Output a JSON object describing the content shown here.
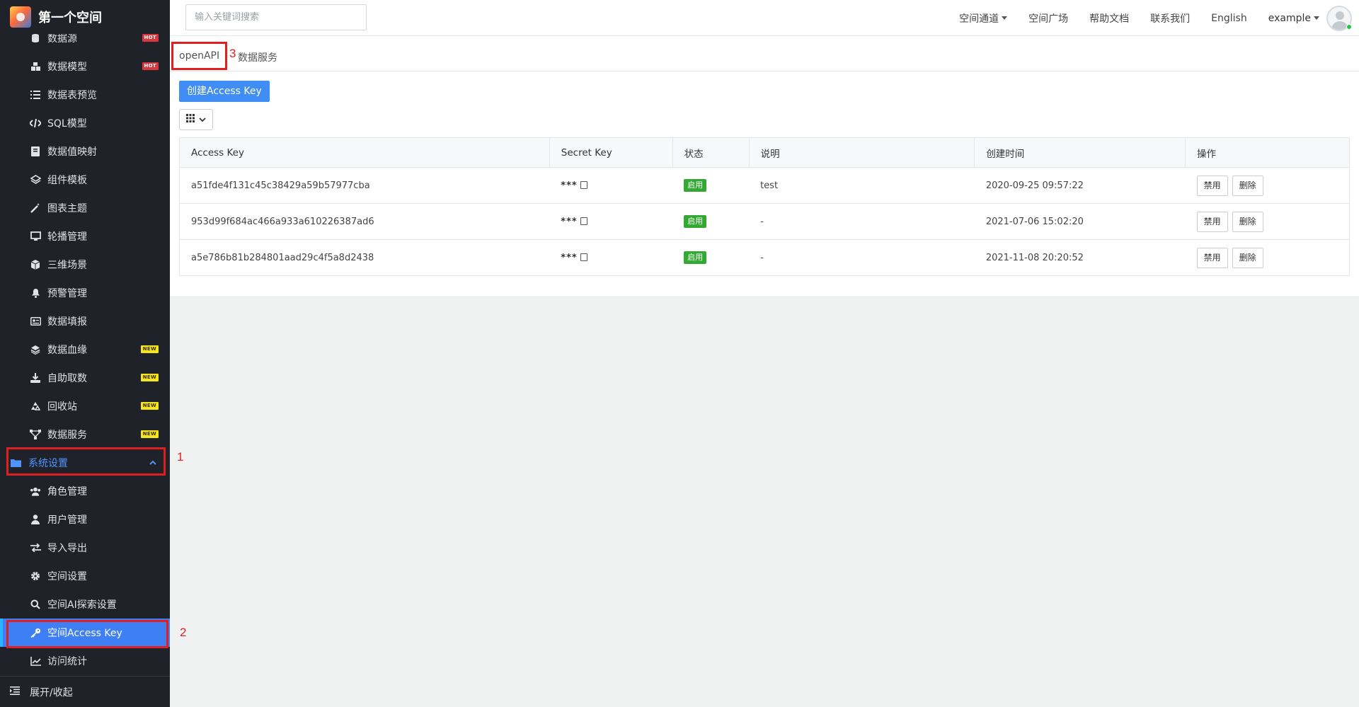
{
  "app": {
    "title": "第一个空间",
    "logo_icon": "space-logo-icon"
  },
  "sidebar": {
    "items": [
      {
        "label": "数据源",
        "icon": "database-icon",
        "badge": "HOT"
      },
      {
        "label": "数据模型",
        "icon": "cubes-icon",
        "badge": "HOT"
      },
      {
        "label": "数据表预览",
        "icon": "list-icon",
        "badge": ""
      },
      {
        "label": "SQL模型",
        "icon": "code-icon",
        "badge": ""
      },
      {
        "label": "数据值映射",
        "icon": "book-icon",
        "badge": ""
      },
      {
        "label": "组件模板",
        "icon": "layer-group-icon",
        "badge": ""
      },
      {
        "label": "图表主题",
        "icon": "magic-wand-icon",
        "badge": ""
      },
      {
        "label": "轮播管理",
        "icon": "monitor-icon",
        "badge": ""
      },
      {
        "label": "三维场景",
        "icon": "cube-icon",
        "badge": ""
      },
      {
        "label": "预警管理",
        "icon": "bell-icon",
        "badge": ""
      },
      {
        "label": "数据填报",
        "icon": "id-card-icon",
        "badge": ""
      },
      {
        "label": "数据血缘",
        "icon": "layers-icon",
        "badge": "NEW"
      },
      {
        "label": "自助取数",
        "icon": "download-icon",
        "badge": "NEW"
      },
      {
        "label": "回收站",
        "icon": "recycle-icon",
        "badge": "NEW"
      },
      {
        "label": "数据服务",
        "icon": "project-diagram-icon",
        "badge": "NEW"
      }
    ],
    "group": {
      "label": "系统设置",
      "icon": "folder-icon",
      "expanded": true
    },
    "sub_items": [
      {
        "label": "角色管理",
        "icon": "users-icon"
      },
      {
        "label": "用户管理",
        "icon": "user-icon"
      },
      {
        "label": "导入导出",
        "icon": "exchange-icon"
      },
      {
        "label": "空间设置",
        "icon": "gear-icon"
      },
      {
        "label": "空间AI探索设置",
        "icon": "search-icon"
      },
      {
        "label": "空间Access Key",
        "icon": "key-icon",
        "active": true
      },
      {
        "label": "访问统计",
        "icon": "line-chart-icon"
      }
    ],
    "collapse_label": "展开/收起"
  },
  "annotations": {
    "one": "1",
    "two": "2",
    "three": "3"
  },
  "header": {
    "search_placeholder": "输入关键词搜索",
    "links": [
      "空间通道",
      "空间广场",
      "帮助文档",
      "联系我们",
      "English"
    ],
    "user_name": "example"
  },
  "tabs": [
    "openAPI",
    "数据服务"
  ],
  "toolbar": {
    "create_label": "创建Access Key"
  },
  "table": {
    "headers": [
      "Access Key",
      "Secret Key",
      "状态",
      "说明",
      "创建时间",
      "操作"
    ],
    "rows": [
      {
        "access_key": "a51fde4f131c45c38429a59b57977cba",
        "secret": "***",
        "status": "启用",
        "note": "test",
        "created": "2020-09-25 09:57:22",
        "disable": "禁用",
        "delete": "删除"
      },
      {
        "access_key": "953d99f684ac466a933a610226387ad6",
        "secret": "***",
        "status": "启用",
        "note": "-",
        "created": "2021-07-06 15:02:20",
        "disable": "禁用",
        "delete": "删除"
      },
      {
        "access_key": "a5e786b81b284801aad29c4f5a8d2438",
        "secret": "***",
        "status": "启用",
        "note": "-",
        "created": "2021-11-08 20:20:52",
        "disable": "禁用",
        "delete": "删除"
      }
    ]
  },
  "colors": {
    "sidebar_bg": "#1f2329",
    "accent": "#3f7ff6",
    "status_green": "#33a833",
    "annotation_red": "#e02020"
  }
}
